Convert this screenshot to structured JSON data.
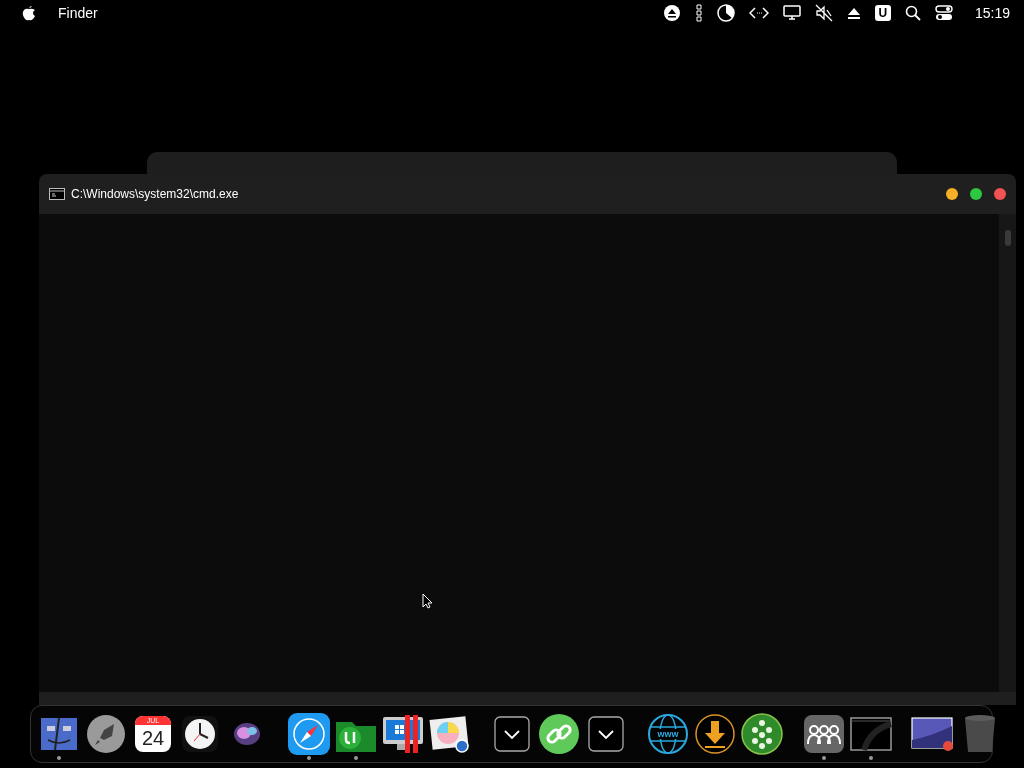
{
  "menu_bar": {
    "app_name": "Finder",
    "status_icons": [
      {
        "kind": "eject"
      },
      {
        "kind": "cpu"
      },
      {
        "kind": "pie"
      },
      {
        "kind": "code"
      },
      {
        "kind": "display"
      },
      {
        "kind": "mute"
      },
      {
        "kind": "eject-plain"
      },
      {
        "kind": "u-box"
      },
      {
        "kind": "search"
      },
      {
        "kind": "toggles"
      }
    ],
    "u_label": "U",
    "clock": "15:19"
  },
  "back_window": {
    "kind": "terminal"
  },
  "window": {
    "title": "C:\\Windows\\system32\\cmd.exe"
  },
  "dock": {
    "groups": [
      [
        {
          "kind": "finder",
          "running": true
        },
        {
          "kind": "rocket",
          "running": false
        },
        {
          "kind": "calendar",
          "running": false,
          "month": "JUL",
          "day": "24"
        },
        {
          "kind": "clock",
          "running": false
        },
        {
          "kind": "siri",
          "running": false
        }
      ],
      [
        {
          "kind": "compass",
          "running": true
        },
        {
          "kind": "torrent",
          "running": true
        },
        {
          "kind": "imac",
          "running": false
        },
        {
          "kind": "photos",
          "running": false
        }
      ],
      [
        {
          "kind": "chevron",
          "running": false
        },
        {
          "kind": "link",
          "running": false
        },
        {
          "kind": "chevron",
          "running": false
        }
      ],
      [
        {
          "kind": "globe",
          "running": false,
          "label": "www"
        },
        {
          "kind": "download",
          "running": false
        },
        {
          "kind": "crowd",
          "running": false
        }
      ],
      [
        {
          "kind": "people",
          "running": true
        },
        {
          "kind": "terminal",
          "running": true
        }
      ],
      [
        {
          "kind": "screen",
          "running": false
        },
        {
          "kind": "trash",
          "running": false
        }
      ]
    ]
  }
}
